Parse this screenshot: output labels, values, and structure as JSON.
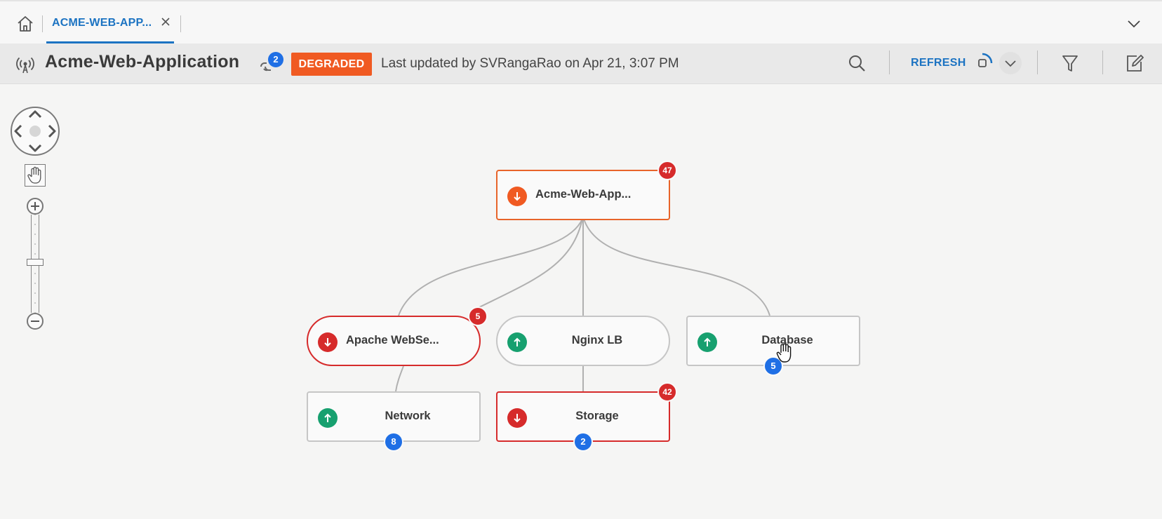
{
  "tabs": {
    "home_icon": "home-icon",
    "active_tab": {
      "label": "ACME-WEB-APP...",
      "close_icon": "close-icon"
    },
    "collapse_icon": "chevron-down-icon"
  },
  "header": {
    "app_icon": "broadcast-icon",
    "title": "Acme-Web-Application",
    "link_icon": "link-icon",
    "link_count": "2",
    "status": "DEGRADED",
    "last_updated": "Last updated by SVRangaRao on Apr 21, 3:07 PM",
    "search_icon": "search-icon",
    "refresh_label": "REFRESH",
    "filter_icon": "filter-icon",
    "edit_icon": "edit-icon"
  },
  "colors": {
    "accent": "#1c73c2",
    "degraded": "#f05a22",
    "down": "#d62b2b",
    "up": "#17a06f",
    "badge_blue": "#1f6fe5"
  },
  "topology": {
    "nodes": [
      {
        "id": "root",
        "label": "Acme-Web-App...",
        "status": "degraded",
        "alerts": "47",
        "children": ""
      },
      {
        "id": "apache",
        "label": "Apache WebSe...",
        "status": "down",
        "alerts": "5",
        "children": ""
      },
      {
        "id": "nginx",
        "label": "Nginx LB",
        "status": "up",
        "alerts": "",
        "children": ""
      },
      {
        "id": "database",
        "label": "Database",
        "status": "up",
        "alerts": "",
        "children": "5"
      },
      {
        "id": "network",
        "label": "Network",
        "status": "up",
        "alerts": "",
        "children": "8"
      },
      {
        "id": "storage",
        "label": "Storage",
        "status": "down",
        "alerts": "42",
        "children": "2"
      }
    ]
  }
}
